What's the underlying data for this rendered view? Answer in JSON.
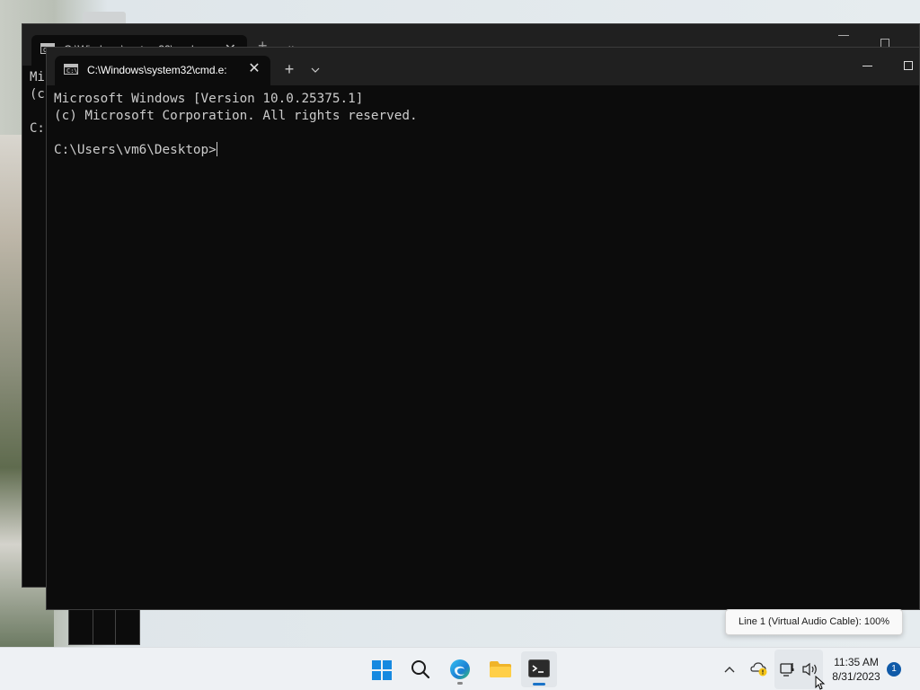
{
  "back_window": {
    "tab_title": "C:\\Windows\\system32\\cmd.e",
    "tab_close": "✕",
    "new_tab": "+",
    "dropdown": "⌄",
    "line1": "Mi",
    "line2": "(c",
    "line3": "C:"
  },
  "front_window": {
    "tab_icon_text": "C:\\",
    "tab_title": "C:\\Windows\\system32\\cmd.e:",
    "tab_close": "✕",
    "new_tab": "+",
    "dropdown": "⌄",
    "terminal": {
      "line1": "Microsoft Windows [Version 10.0.25375.1]",
      "line2": "(c) Microsoft Corporation. All rights reserved.",
      "prompt": "C:\\Users\\vm6\\Desktop>"
    }
  },
  "tooltip": {
    "text": "Line 1 (Virtual Audio Cable): 100%"
  },
  "taskbar": {
    "apps": [
      {
        "name": "start",
        "icon": "windows-logo-icon",
        "active": false
      },
      {
        "name": "search",
        "icon": "search-icon",
        "active": false
      },
      {
        "name": "edge",
        "icon": "edge-icon",
        "active": false
      },
      {
        "name": "file-explorer",
        "icon": "folder-icon",
        "active": false
      },
      {
        "name": "terminal",
        "icon": "terminal-icon",
        "active": true
      }
    ],
    "tray": {
      "overflow": "^",
      "time": "11:35 AM",
      "date": "8/31/2023",
      "notification_count": "1"
    }
  },
  "colors": {
    "terminal_bg": "#0c0c0c",
    "titlebar_bg": "#202020",
    "terminal_text": "#cccccc",
    "taskbar_bg": "#eef1f4",
    "accent": "#1689e0"
  }
}
